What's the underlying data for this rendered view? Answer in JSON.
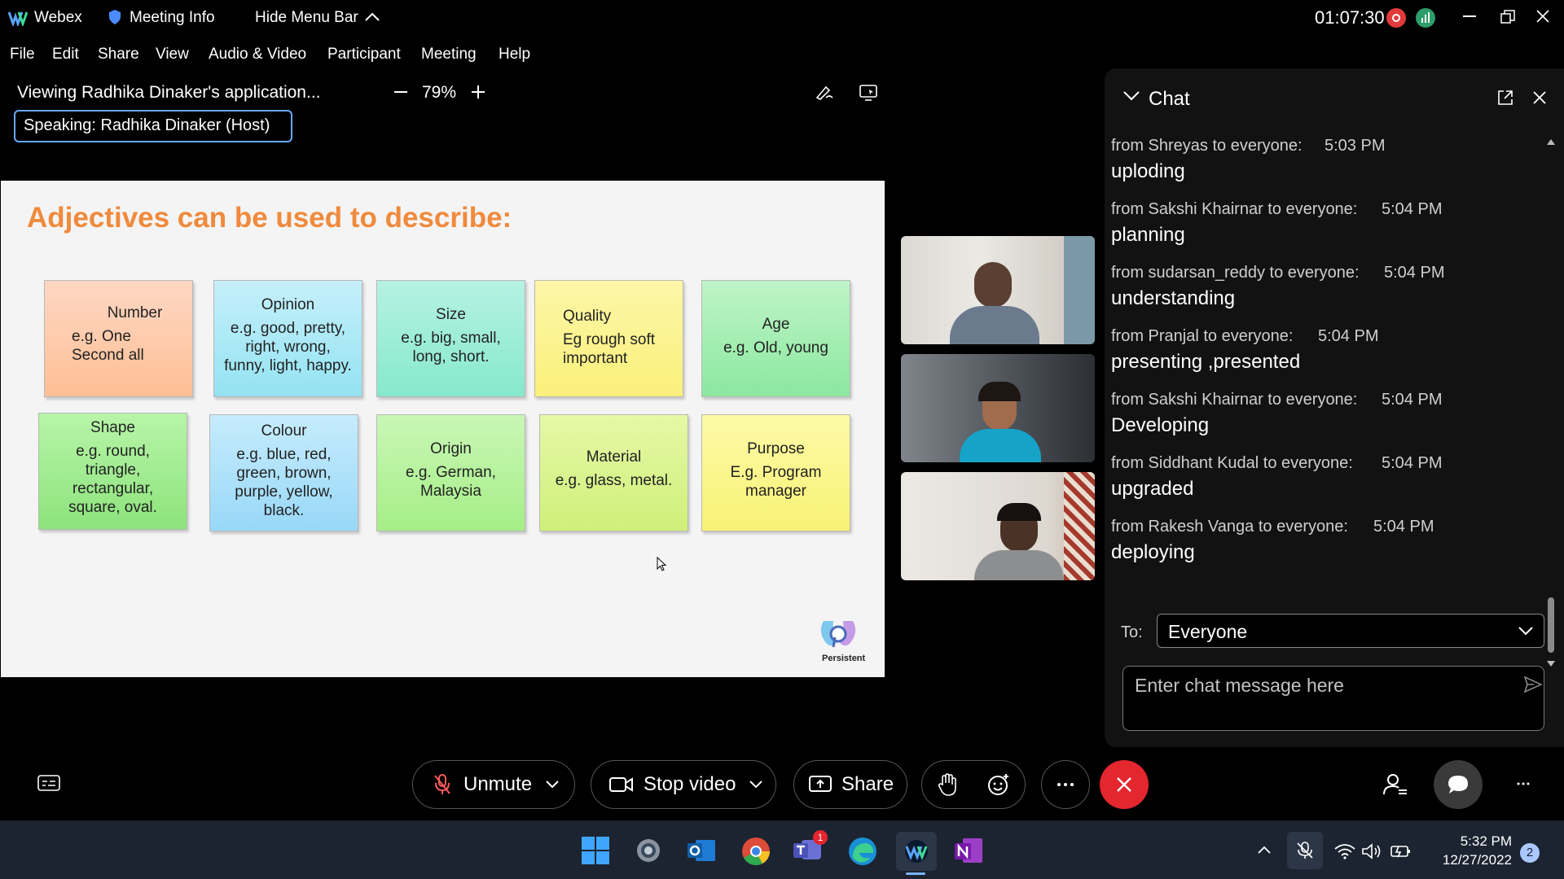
{
  "titlebar": {
    "app_name": "Webex",
    "meeting_info": "Meeting Info",
    "hide_menu_bar": "Hide Menu Bar",
    "timer": "01:07:30"
  },
  "menu": [
    "File",
    "Edit",
    "Share",
    "View",
    "Audio & Video",
    "Participant",
    "Meeting",
    "Help"
  ],
  "viewer": {
    "viewing_text": "Viewing Radhika Dinaker's application...",
    "zoom": "79%",
    "speaking_label": "Speaking:",
    "speaker": "Radhika Dinaker (Host)"
  },
  "slide": {
    "title": "Adjectives can be used to describe:",
    "boxes": [
      {
        "heading": "Number",
        "body": "e.g. One\nSecond all"
      },
      {
        "heading": "Opinion",
        "body": "e.g. good, pretty,\nright, wrong,\nfunny, light, happy."
      },
      {
        "heading": "Size",
        "body": "e.g. big, small,\nlong, short."
      },
      {
        "heading": "Quality",
        "body": "Eg rough soft\nimportant"
      },
      {
        "heading": "Age",
        "body": "e.g. Old, young"
      },
      {
        "heading": "Shape",
        "body": "e.g. round,\ntriangle,\nrectangular,\nsquare, oval."
      },
      {
        "heading": "Colour",
        "body": "e.g. blue, red,\ngreen, brown,\npurple, yellow,\nblack."
      },
      {
        "heading": "Origin",
        "body": "e.g. German,\nMalaysia"
      },
      {
        "heading": "Material",
        "body": "e.g. glass, metal."
      },
      {
        "heading": "Purpose",
        "body": "E.g. Program\nmanager"
      }
    ],
    "logo_text": "Persistent"
  },
  "chat": {
    "title": "Chat",
    "messages": [
      {
        "from": "from Shreyas to everyone:",
        "time": "5:03 PM",
        "text": "uploding"
      },
      {
        "from": "from Sakshi Khairnar to everyone:",
        "time": "5:04 PM",
        "text": "planning"
      },
      {
        "from": "from sudarsan_reddy to everyone:",
        "time": "5:04 PM",
        "text": "understanding"
      },
      {
        "from": "from Pranjal to everyone:",
        "time": "5:04 PM",
        "text": "presenting ,presented"
      },
      {
        "from": "from Sakshi Khairnar to everyone:",
        "time": "5:04 PM",
        "text": "Developing"
      },
      {
        "from": "from Siddhant Kudal to everyone:",
        "time": "5:04 PM",
        "text": "upgraded"
      },
      {
        "from": "from Rakesh Vanga to everyone:",
        "time": "5:04 PM",
        "text": "deploying"
      }
    ],
    "to_label": "To:",
    "to_value": "Everyone",
    "input_placeholder": "Enter chat message here"
  },
  "controls": {
    "unmute": "Unmute",
    "stop_video": "Stop video",
    "share": "Share"
  },
  "taskbar": {
    "time": "5:32 PM",
    "date": "12/27/2022",
    "notification_count": "2",
    "teams_badge": "1"
  }
}
